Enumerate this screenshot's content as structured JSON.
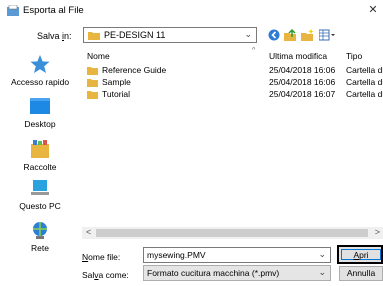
{
  "window": {
    "title": "Esporta al File",
    "close_glyph": "✕"
  },
  "lookin": {
    "label_underlined": "i",
    "label_before": "Salva ",
    "label_after": "n:",
    "value": "PE-DESIGN 11",
    "arrow": "⌄"
  },
  "toolbar": {
    "icons": [
      "back-icon",
      "up-folder-icon",
      "new-folder-icon",
      "view-menu-icon"
    ]
  },
  "places": [
    {
      "label": "Accesso rapido",
      "icon": "star-icon"
    },
    {
      "label": "Desktop",
      "icon": "desktop-icon"
    },
    {
      "label": "Raccolte",
      "icon": "libraries-icon"
    },
    {
      "label": "Questo PC",
      "icon": "computer-icon"
    },
    {
      "label": "Rete",
      "icon": "network-icon"
    }
  ],
  "filelist": {
    "columns": {
      "name": "Nome",
      "modified": "Ultima modifica",
      "type": "Tipo"
    },
    "sort_caret": "^",
    "rows": [
      {
        "name": "Reference Guide",
        "date": "25/04/2018 16:06",
        "type": "Cartella di file"
      },
      {
        "name": "Sample",
        "date": "25/04/2018 16:06",
        "type": "Cartella di file"
      },
      {
        "name": "Tutorial",
        "date": "25/04/2018 16:07",
        "type": "Cartella di file"
      }
    ]
  },
  "scroll": {
    "left": "<",
    "right": ">"
  },
  "filename": {
    "label_underlined": "N",
    "label_rest": "ome file:",
    "value": "mysewing.PMV",
    "arrow": "⌄"
  },
  "filetype": {
    "label_before": "Sal",
    "label_underlined": "v",
    "label_after": "a come:",
    "value": "Formato cucitura macchina (*.pmv)",
    "arrow": "⌄"
  },
  "buttons": {
    "open_underlined": "A",
    "open_rest": "pri",
    "cancel": "Annulla"
  },
  "colors": {
    "accent": "#0078d7",
    "folder": "#e8b640"
  }
}
